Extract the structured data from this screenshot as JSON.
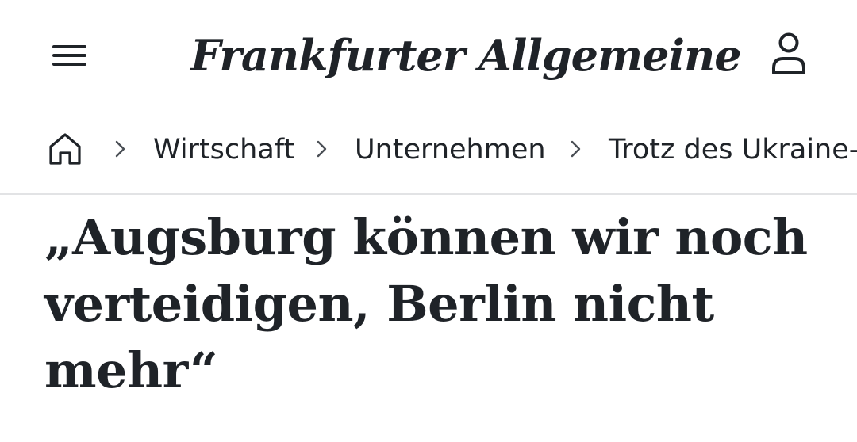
{
  "header": {
    "logo_text": "Frankfurter Allgemeine",
    "menu_icon": "hamburger-menu-icon",
    "user_icon": "user-account-icon"
  },
  "breadcrumb": {
    "home_icon": "home-icon",
    "separator_icon": "chevron-right-icon",
    "items": [
      {
        "label": "Wirtschaft"
      },
      {
        "label": "Unternehmen"
      },
      {
        "label": "Trotz des Ukraine-"
      }
    ]
  },
  "article": {
    "headline": "„Augsburg können wir noch verteidigen, Berlin nicht mehr“"
  },
  "colors": {
    "text": "#1f2328",
    "divider": "#e2e3e5",
    "background": "#ffffff"
  }
}
